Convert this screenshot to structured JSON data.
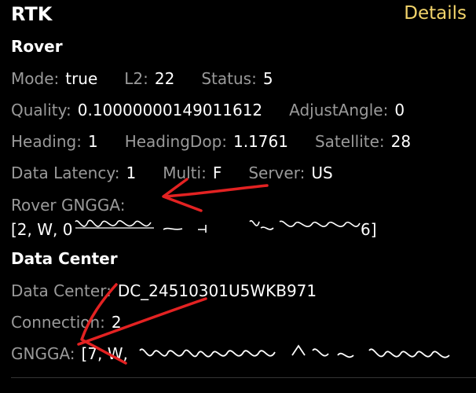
{
  "header": {
    "title": "RTK",
    "details_label": "Details"
  },
  "rover": {
    "section_title": "Rover",
    "mode_label": "Mode:",
    "mode_value": "true",
    "l2_label": "L2:",
    "l2_value": "22",
    "status_label": "Status:",
    "status_value": "5",
    "quality_label": "Quality:",
    "quality_value": "0.10000000149011612",
    "adjust_label": "AdjustAngle:",
    "adjust_value": "0",
    "heading_label": "Heading:",
    "heading_value": "1",
    "headingdop_label": "HeadingDop:",
    "headingdop_value": "1.1761",
    "satellite_label": "Satellite:",
    "satellite_value": "28",
    "latency_label": "Data Latency:",
    "latency_value": "1",
    "multi_label": "Multi:",
    "multi_value": "F",
    "server_label": "Server:",
    "server_value": "US",
    "gngga_label": "Rover GNGGA:",
    "gngga_value_start": "[2, W, 0",
    "gngga_value_end": "6]"
  },
  "datacenter": {
    "section_title": "Data Center",
    "dc_label": "Data Center:",
    "dc_value": "DC_24510301U5WKB971",
    "connection_label": "Connection:",
    "connection_value": "2",
    "gngga_label": "GNGGA:",
    "gngga_value_start": "[7, W,"
  },
  "colors": {
    "accent": "#f2d46b",
    "annotation": "#e32222",
    "label": "#9a9a9a"
  }
}
